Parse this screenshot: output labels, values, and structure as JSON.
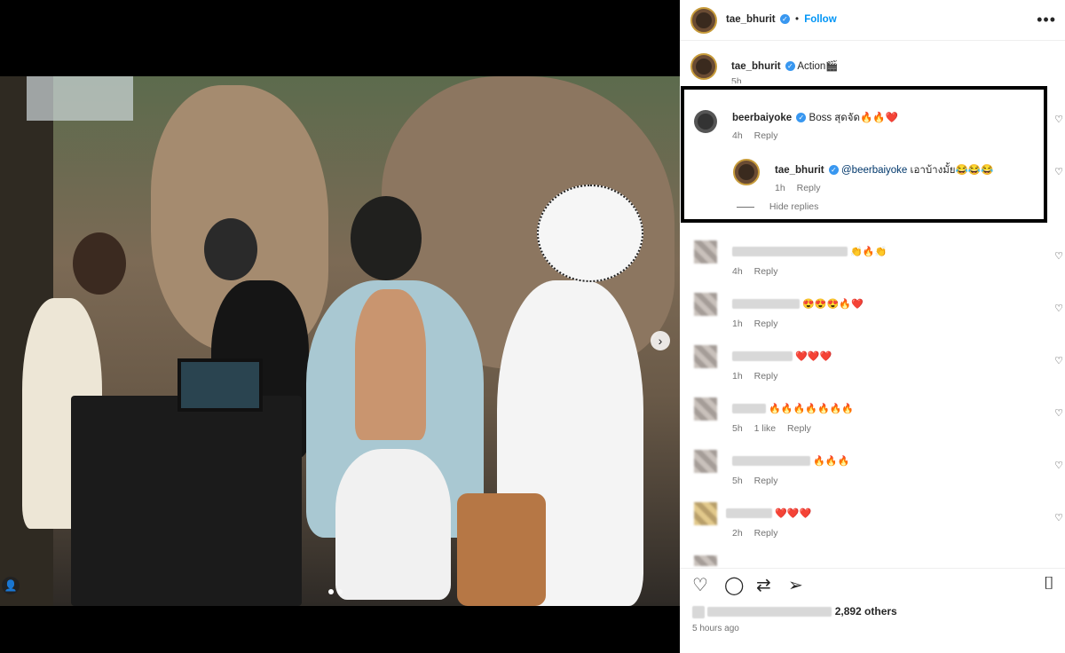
{
  "post": {
    "author": "tae_bhurit",
    "follow_label": "Follow",
    "dot": "•",
    "more_icon": "•••",
    "caption": "Action🎬",
    "caption_time": "5h"
  },
  "media": {
    "carousel_total": 2,
    "carousel_current": 1,
    "next_arrow": "›",
    "tag_icon": "👤"
  },
  "comments_highlight": {
    "author": "beerbaiyoke",
    "text": "Boss สุดจัด🔥🔥❤️",
    "time": "4h",
    "reply_label": "Reply",
    "reply": {
      "author": "tae_bhurit",
      "mention": "@beerbaiyoke",
      "text": "เอาบ้างมั้ย😂😂😂",
      "time": "1h",
      "reply_label": "Reply"
    },
    "hide_replies": "Hide replies"
  },
  "comments": [
    {
      "emoji": "👏🔥👏",
      "time": "4h",
      "likes": "",
      "reply_label": "Reply"
    },
    {
      "emoji": "😍😍😍🔥❤️",
      "time": "1h",
      "likes": "",
      "reply_label": "Reply"
    },
    {
      "emoji": "❤️❤️❤️",
      "time": "1h",
      "likes": "",
      "reply_label": "Reply"
    },
    {
      "emoji": "🔥🔥🔥🔥🔥🔥🔥",
      "time": "5h",
      "likes": "1 like",
      "reply_label": "Reply"
    },
    {
      "emoji": "🔥🔥🔥",
      "time": "5h",
      "likes": "",
      "reply_label": "Reply"
    },
    {
      "emoji": "❤️❤️❤️",
      "time": "2h",
      "likes": "",
      "reply_label": "Reply"
    }
  ],
  "actions": {
    "like_icon": "♡",
    "comment_icon": "◯",
    "share_icon": "⇄",
    "send_icon": "➢",
    "save_icon": "⌷"
  },
  "likes_text": "2,892 others",
  "post_time": "5 hours ago",
  "colors": {
    "accent": "#0095f6",
    "verified": "#3897f0",
    "muted": "#737373"
  }
}
